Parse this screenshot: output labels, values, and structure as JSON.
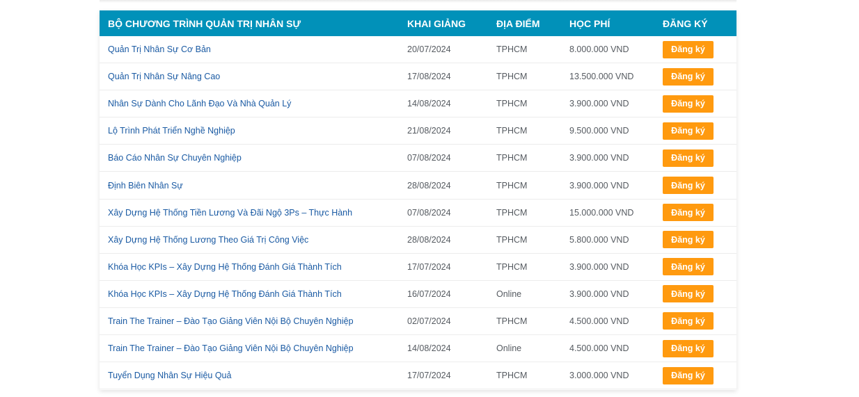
{
  "table": {
    "headers": {
      "program": "BỘ CHƯƠNG TRÌNH QUẢN TRỊ NHÂN SỰ",
      "start": "KHAI GIẢNG",
      "location": "ĐỊA ĐIỂM",
      "fee": "HỌC PHÍ",
      "register": "ĐĂNG KÝ"
    },
    "register_label": "Đăng ký",
    "rows": [
      {
        "course": "Quản Trị Nhân Sự Cơ Bản",
        "start": "20/07/2024",
        "location": "TPHCM",
        "fee": "8.000.000 VND"
      },
      {
        "course": "Quản Trị Nhân Sự Nâng Cao",
        "start": "17/08/2024",
        "location": "TPHCM",
        "fee": "13.500.000 VND"
      },
      {
        "course": "Nhân Sự Dành Cho Lãnh Đạo Và Nhà Quản Lý",
        "start": "14/08/2024",
        "location": "TPHCM",
        "fee": "3.900.000 VND"
      },
      {
        "course": "Lộ Trình Phát Triển Nghề Nghiệp",
        "start": "21/08/2024",
        "location": "TPHCM",
        "fee": "9.500.000 VND"
      },
      {
        "course": "Báo Cáo Nhân Sự Chuyên Nghiệp",
        "start": "07/08/2024",
        "location": "TPHCM",
        "fee": "3.900.000 VND"
      },
      {
        "course": "Định Biên Nhân Sự",
        "start": "28/08/2024",
        "location": "TPHCM",
        "fee": "3.900.000 VND"
      },
      {
        "course": "Xây Dựng Hệ Thống Tiền Lương Và Đãi Ngộ 3Ps – Thực Hành",
        "start": "07/08/2024",
        "location": "TPHCM",
        "fee": "15.000.000 VND"
      },
      {
        "course": "Xây Dựng Hệ Thống Lương Theo Giá Trị Công Việc",
        "start": "28/08/2024",
        "location": "TPHCM",
        "fee": "5.800.000 VND"
      },
      {
        "course": "Khóa Học KPIs – Xây Dựng Hệ Thống Đánh Giá Thành Tích",
        "start": "17/07/2024",
        "location": "TPHCM",
        "fee": "3.900.000 VND"
      },
      {
        "course": "Khóa Học KPIs – Xây Dựng Hệ Thống Đánh Giá Thành Tích",
        "start": "16/07/2024",
        "location": "Online",
        "fee": "3.900.000 VND"
      },
      {
        "course": "Train The Trainer – Đào Tạo Giảng Viên Nội Bộ Chuyên Nghiệp",
        "start": "02/07/2024",
        "location": "TPHCM",
        "fee": "4.500.000 VND"
      },
      {
        "course": "Train The Trainer – Đào Tạo Giảng Viên Nội Bộ Chuyên Nghiệp",
        "start": "14/08/2024",
        "location": "Online",
        "fee": "4.500.000 VND"
      },
      {
        "course": "Tuyển Dụng Nhân Sự Hiệu Quả",
        "start": "17/07/2024",
        "location": "TPHCM",
        "fee": "3.000.000 VND"
      }
    ]
  },
  "colors": {
    "header_bg": "#0191b9",
    "link": "#1a5aa3",
    "button": "#ff9a0f"
  }
}
